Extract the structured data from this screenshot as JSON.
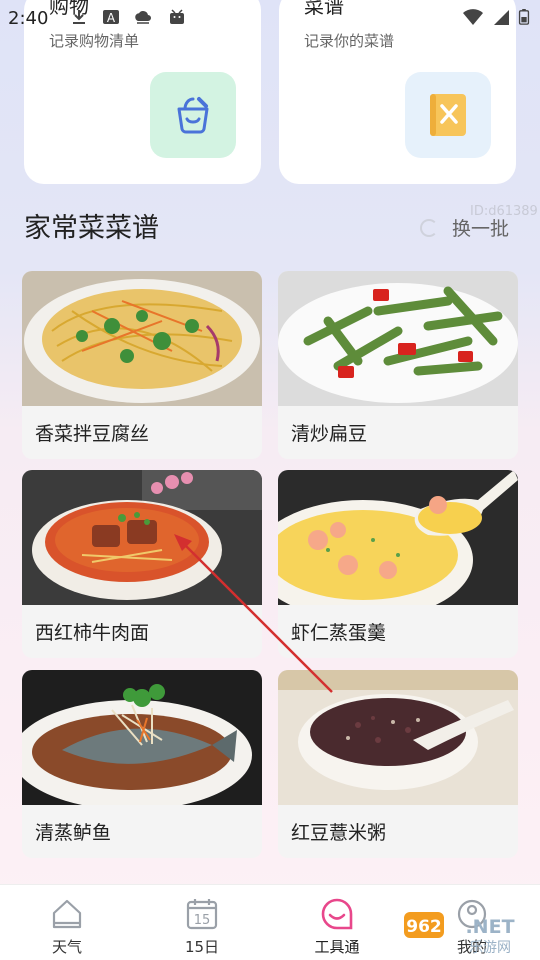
{
  "status_bar": {
    "time": "2:40"
  },
  "tools": [
    {
      "title": "购物",
      "subtitle": "记录购物清单",
      "icon": "shopping-basket-icon",
      "color": "#d3f3e2",
      "icon_color": "#4a73d9"
    },
    {
      "title": "菜谱",
      "subtitle": "记录你的菜谱",
      "icon": "recipe-book-icon",
      "color": "#e6f1fb",
      "icon_color": "#f7c55a"
    }
  ],
  "section": {
    "title": "家常菜菜谱",
    "refresh_label": "换一批",
    "watermark_id": "ID:d61389"
  },
  "recipes": [
    {
      "name": "香菜拌豆腐丝"
    },
    {
      "name": "清炒扁豆"
    },
    {
      "name": "西红柿牛肉面"
    },
    {
      "name": "虾仁蒸蛋羹"
    },
    {
      "name": "清蒸鲈鱼"
    },
    {
      "name": "红豆薏米粥"
    }
  ],
  "nav": [
    {
      "label": "天气",
      "icon": "weather-home-icon"
    },
    {
      "label": "15日",
      "icon": "calendar-icon",
      "icon_text": "15"
    },
    {
      "label": "工具通",
      "icon": "tools-smile-icon",
      "active": true
    },
    {
      "label": "我的",
      "icon": "profile-icon"
    }
  ],
  "brand_watermark": {
    "logo": "962.NET",
    "sub": "乐游网"
  },
  "colors": {
    "accent": "#e8478b",
    "arrow": "#d32f2f"
  }
}
